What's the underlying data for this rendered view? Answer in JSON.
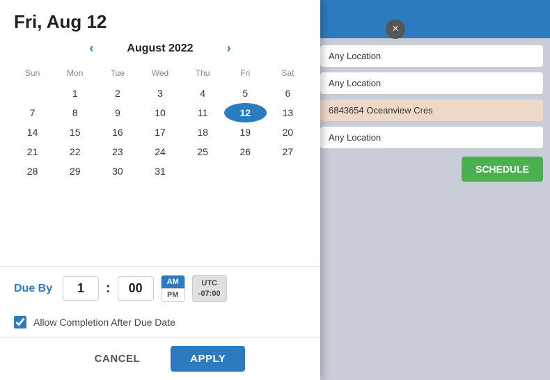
{
  "modal": {
    "title": "Fri, Aug 12",
    "close_icon": "×"
  },
  "calendar": {
    "month_year": "August 2022",
    "prev_icon": "‹",
    "next_icon": "›",
    "weekdays": [
      "Sun",
      "Mon",
      "Tue",
      "Wed",
      "Thu",
      "Fri",
      "Sat"
    ],
    "weeks": [
      [
        null,
        1,
        2,
        3,
        4,
        5,
        6
      ],
      [
        7,
        8,
        9,
        10,
        11,
        12,
        13
      ],
      [
        14,
        15,
        16,
        17,
        18,
        19,
        20
      ],
      [
        21,
        22,
        23,
        24,
        25,
        26,
        27
      ],
      [
        28,
        29,
        30,
        31,
        null,
        null,
        null
      ]
    ],
    "selected_day": 12
  },
  "due_by": {
    "label": "Due By",
    "hour": "1",
    "minutes": "00",
    "am": "AM",
    "pm": "PM",
    "timezone": "UTC\n-07:00",
    "active_period": "AM"
  },
  "checkbox": {
    "label": "Allow Completion After Due Date",
    "checked": true
  },
  "footer": {
    "cancel_label": "CANCEL",
    "apply_label": "APPLY"
  },
  "background": {
    "rows": [
      {
        "text": "Any Location",
        "type": "normal"
      },
      {
        "text": "Any Location",
        "type": "normal"
      },
      {
        "text": "6843654 Oceanview Cres",
        "type": "highlight"
      },
      {
        "text": "Any Location",
        "type": "normal"
      }
    ],
    "schedule_button": "SCHEDULE"
  }
}
